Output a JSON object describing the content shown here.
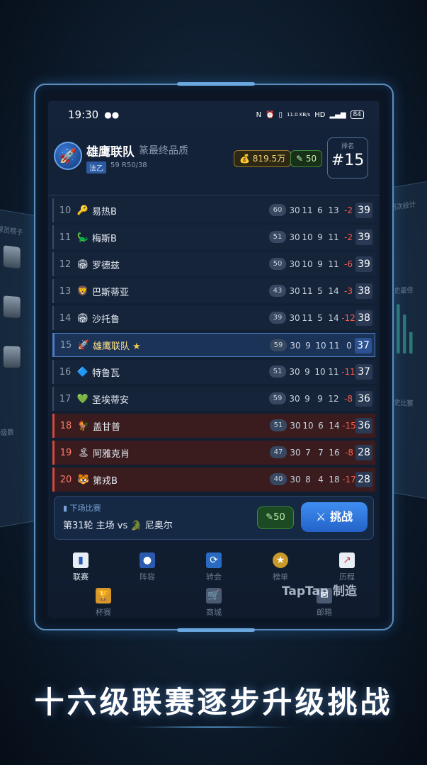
{
  "status": {
    "time": "19:30",
    "speed": "11.0\nKB/s",
    "battery": "84"
  },
  "header": {
    "club_name": "雄鹰联队",
    "club_sub": "篆最终品质",
    "league": "法乙",
    "progress": "59 R50/38",
    "coins": "819.5万",
    "tickets": "50",
    "rank_label": "排名",
    "rank_value": "#15"
  },
  "table": {
    "rows": [
      {
        "pos": "10",
        "icon": "🔑",
        "name": "易热B",
        "pill": "60",
        "n": [
          "30",
          "11",
          "6",
          "13"
        ],
        "gd": "-2",
        "pts": "39",
        "type": "normal"
      },
      {
        "pos": "11",
        "icon": "🦕",
        "name": "梅斯B",
        "pill": "51",
        "n": [
          "30",
          "10",
          "9",
          "11"
        ],
        "gd": "-2",
        "pts": "39",
        "type": "normal"
      },
      {
        "pos": "12",
        "icon": "🏟",
        "name": "罗德兹",
        "pill": "50",
        "n": [
          "30",
          "10",
          "9",
          "11"
        ],
        "gd": "-6",
        "pts": "39",
        "type": "normal"
      },
      {
        "pos": "13",
        "icon": "🦁",
        "name": "巴斯蒂亚",
        "pill": "43",
        "n": [
          "30",
          "11",
          "5",
          "14"
        ],
        "gd": "-3",
        "pts": "38",
        "type": "normal"
      },
      {
        "pos": "14",
        "icon": "🏟",
        "name": "沙托鲁",
        "pill": "39",
        "n": [
          "30",
          "11",
          "5",
          "14"
        ],
        "gd": "-12",
        "pts": "38",
        "type": "normal"
      },
      {
        "pos": "15",
        "icon": "🚀",
        "name": "雄鹰联队",
        "pill": "59",
        "n": [
          "30",
          "9",
          "10",
          "11"
        ],
        "gd": "0",
        "pts": "37",
        "type": "mine"
      },
      {
        "pos": "16",
        "icon": "🔷",
        "name": "特鲁瓦",
        "pill": "51",
        "n": [
          "30",
          "9",
          "10",
          "11"
        ],
        "gd": "-11",
        "pts": "37",
        "type": "normal"
      },
      {
        "pos": "17",
        "icon": "💚",
        "name": "圣埃蒂安",
        "pill": "59",
        "n": [
          "30",
          "9",
          "9",
          "12"
        ],
        "gd": "-8",
        "pts": "36",
        "type": "normal"
      },
      {
        "pos": "18",
        "icon": "🐓",
        "name": "盖甘普",
        "pill": "51",
        "n": [
          "30",
          "10",
          "6",
          "14"
        ],
        "gd": "-15",
        "pts": "36",
        "type": "relegate"
      },
      {
        "pos": "19",
        "icon": "🏝",
        "name": "阿雅克肖",
        "pill": "47",
        "n": [
          "30",
          "7",
          "7",
          "16"
        ],
        "gd": "-8",
        "pts": "28",
        "type": "relegate"
      },
      {
        "pos": "20",
        "icon": "🐯",
        "name": "第戎B",
        "pill": "40",
        "n": [
          "30",
          "8",
          "4",
          "18"
        ],
        "gd": "-17",
        "pts": "28",
        "type": "relegate"
      }
    ]
  },
  "next_match": {
    "title": "下场比赛",
    "info": "第31轮 主场 vs 🐊 尼奥尔",
    "ticket": "50",
    "challenge": "⚔ 挑战"
  },
  "nav": {
    "league": "联赛",
    "lineup": "阵容",
    "transfer": "转会",
    "ranking": "榜单",
    "history": "历程",
    "cup": "杯赛",
    "shop": "商城",
    "mail": "邮箱"
  },
  "watermark": "TapTap 制造",
  "caption": "十六级联赛逐步升级挑战",
  "background_ghost": {
    "left_title": "球员榜子",
    "left_bottom": "等级数",
    "right_top": "历次统计",
    "right_mid": "历史最佳",
    "right_bottom": "历史比赛"
  }
}
